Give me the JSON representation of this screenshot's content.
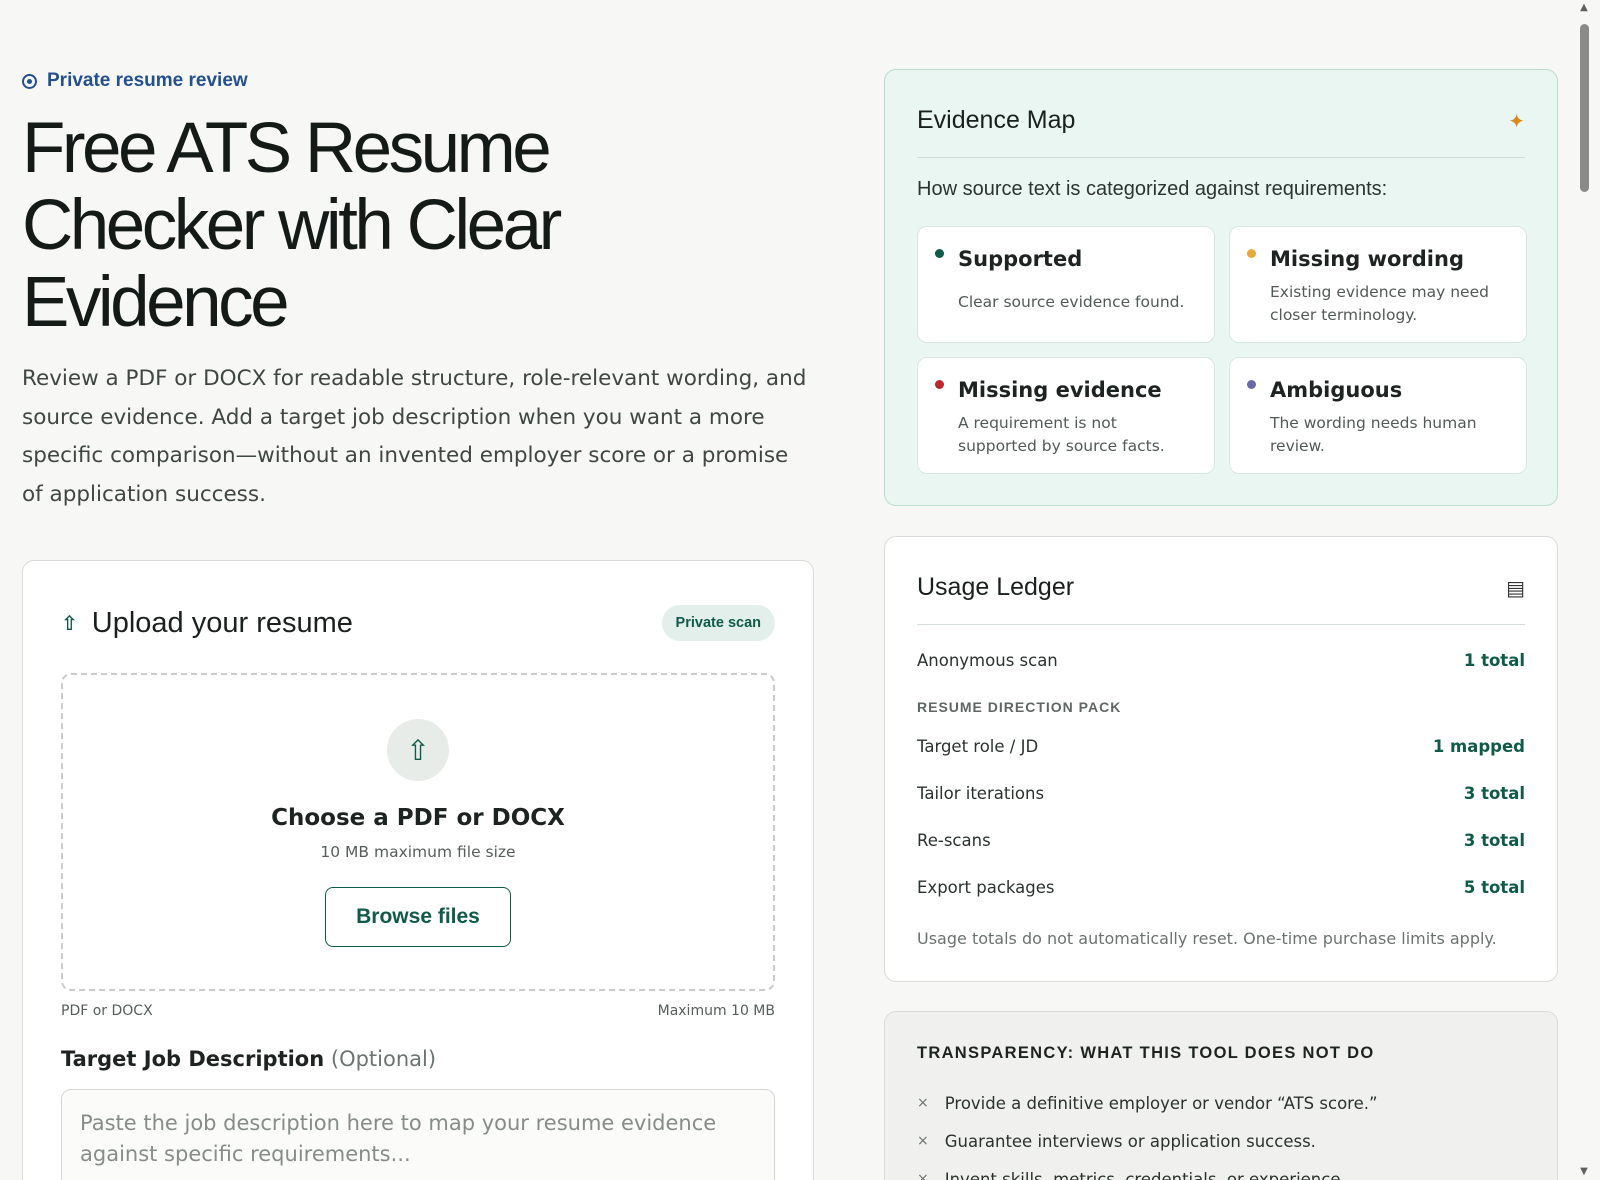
{
  "hero": {
    "eyebrow": "Private resume review",
    "title": "Free ATS Resume Checker with Clear Evidence",
    "description": "Review a PDF or DOCX for readable structure, role-relevant wording, and source evidence. Add a target job description when you want a more specific comparison—without an invented employer score or a promise of application success."
  },
  "upload": {
    "title": "Upload your resume",
    "badge": "Private scan",
    "dropzone_title": "Choose a PDF or DOCX",
    "dropzone_sub": "10 MB maximum file size",
    "browse_label": "Browse files",
    "meta_left": "PDF or DOCX",
    "meta_right": "Maximum 10 MB",
    "jd_label": "Target Job Description",
    "jd_optional": "(Optional)",
    "jd_placeholder": "Paste the job description here to map your resume evidence against specific requirements...",
    "jd_value": ""
  },
  "evidence_map": {
    "title": "Evidence Map",
    "intro": "How source text is categorized against requirements:",
    "items": [
      {
        "name": "Supported",
        "desc": "Clear source evidence found.",
        "color": "#0f5a48"
      },
      {
        "name": "Missing wording",
        "desc": "Existing evidence may need closer terminology.",
        "color": "#e7a93b"
      },
      {
        "name": "Missing evidence",
        "desc": "A requirement is not supported by source facts.",
        "color": "#c0262d"
      },
      {
        "name": "Ambiguous",
        "desc": "The wording needs human review.",
        "color": "#6a6aa8"
      }
    ]
  },
  "usage_ledger": {
    "title": "Usage Ledger",
    "anon_label": "Anonymous scan",
    "anon_value": "1 total",
    "section_label": "RESUME DIRECTION PACK",
    "rows": [
      {
        "label": "Target role / JD",
        "value": "1 mapped"
      },
      {
        "label": "Tailor iterations",
        "value": "3 total"
      },
      {
        "label": "Re-scans",
        "value": "3 total"
      },
      {
        "label": "Export packages",
        "value": "5 total"
      }
    ],
    "note": "Usage totals do not automatically reset. One-time purchase limits apply."
  },
  "transparency": {
    "title": "TRANSPARENCY: WHAT THIS TOOL DOES NOT DO",
    "items": [
      "Provide a definitive employer or vendor “ATS score.”",
      "Guarantee interviews or application success.",
      "Invent skills, metrics, credentials, or experience."
    ]
  }
}
